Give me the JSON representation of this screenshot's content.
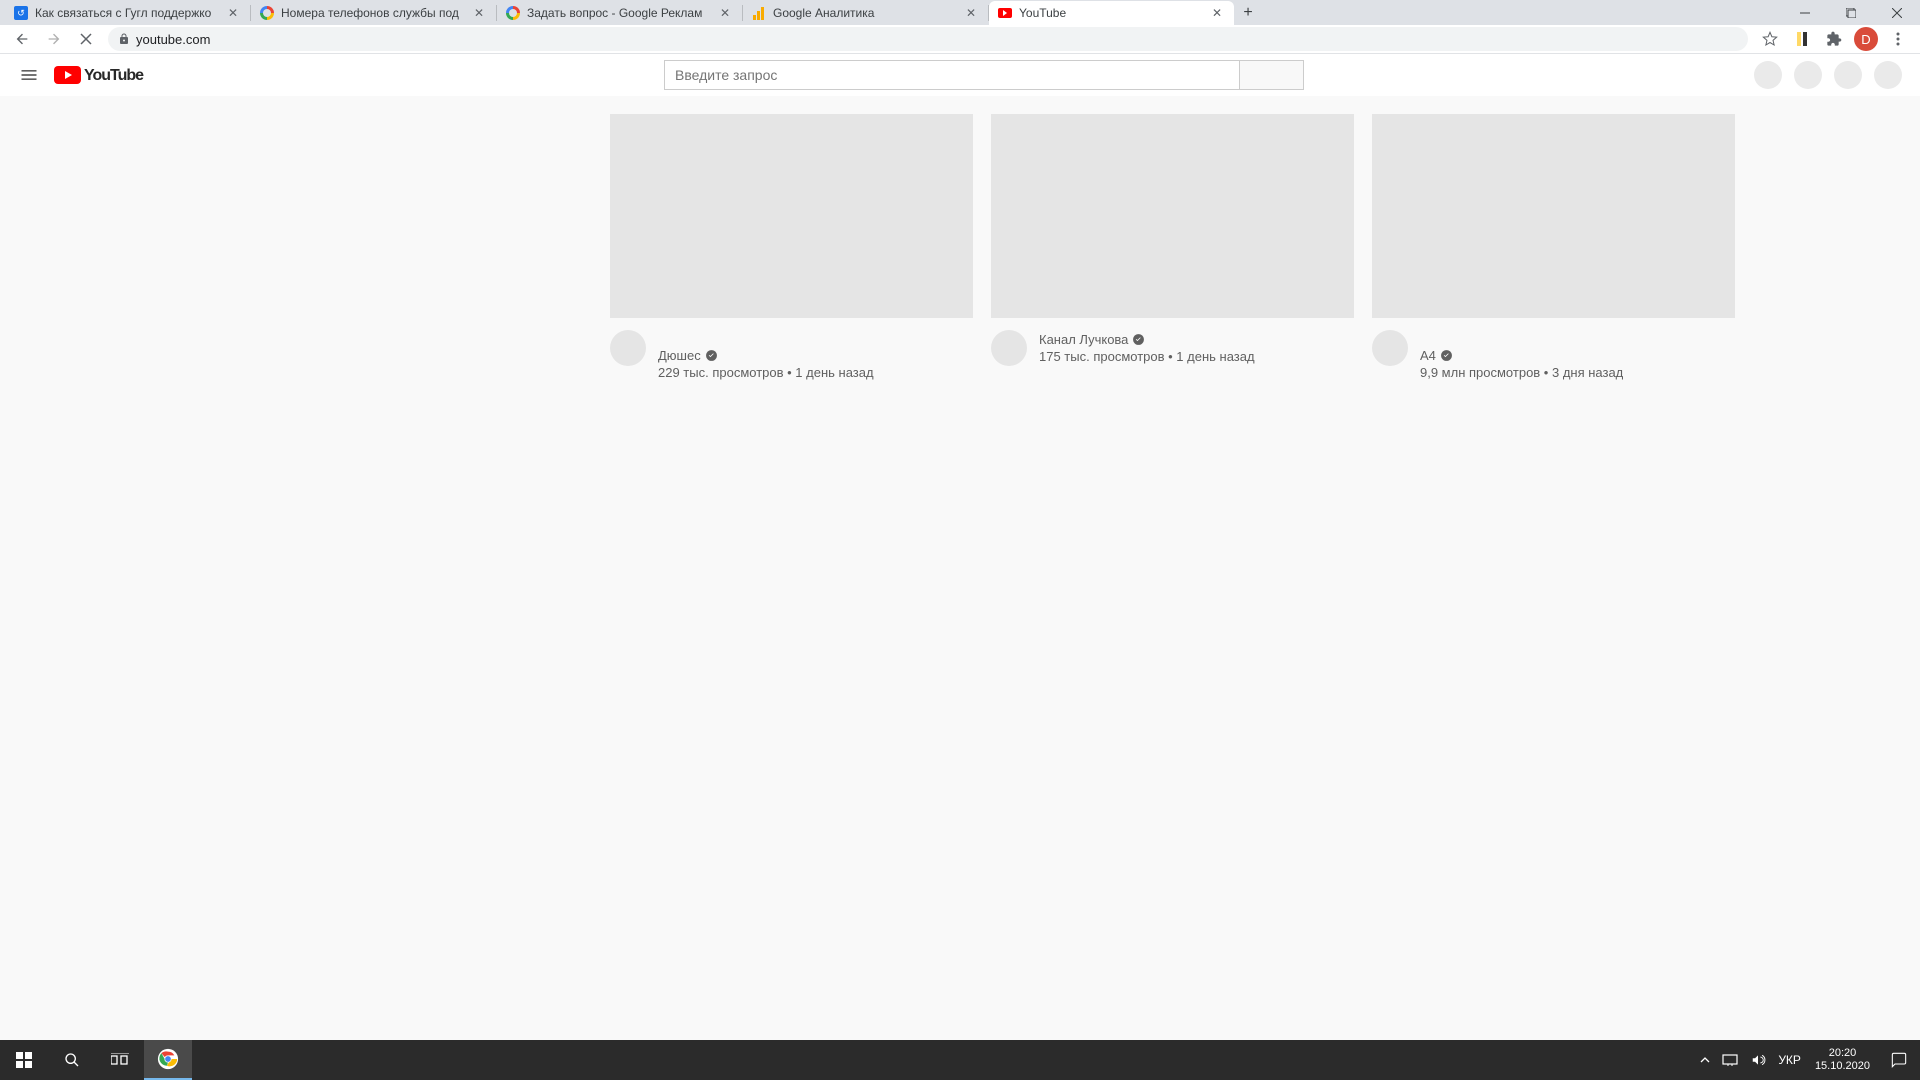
{
  "browser": {
    "tabs": [
      {
        "title": "Как связаться с Гугл поддержко"
      },
      {
        "title": "Номера телефонов службы под"
      },
      {
        "title": "Задать вопрос - Google Реклам"
      },
      {
        "title": "Google Аналитика"
      },
      {
        "title": "YouTube",
        "active": true
      }
    ],
    "url": "youtube.com",
    "profile_letter": "D"
  },
  "youtube": {
    "search_placeholder": "Введите запрос",
    "videos": [
      {
        "channel": "Дюшес",
        "stats": "229 тыс. просмотров • 1 день назад"
      },
      {
        "channel": "Канал Лучкова",
        "stats": "175 тыс. просмотров • 1 день назад"
      },
      {
        "channel": "А4",
        "stats": "9,9 млн просмотров • 3 дня назад"
      }
    ]
  },
  "taskbar": {
    "language": "УКР",
    "time": "20:20",
    "date": "15.10.2020"
  }
}
